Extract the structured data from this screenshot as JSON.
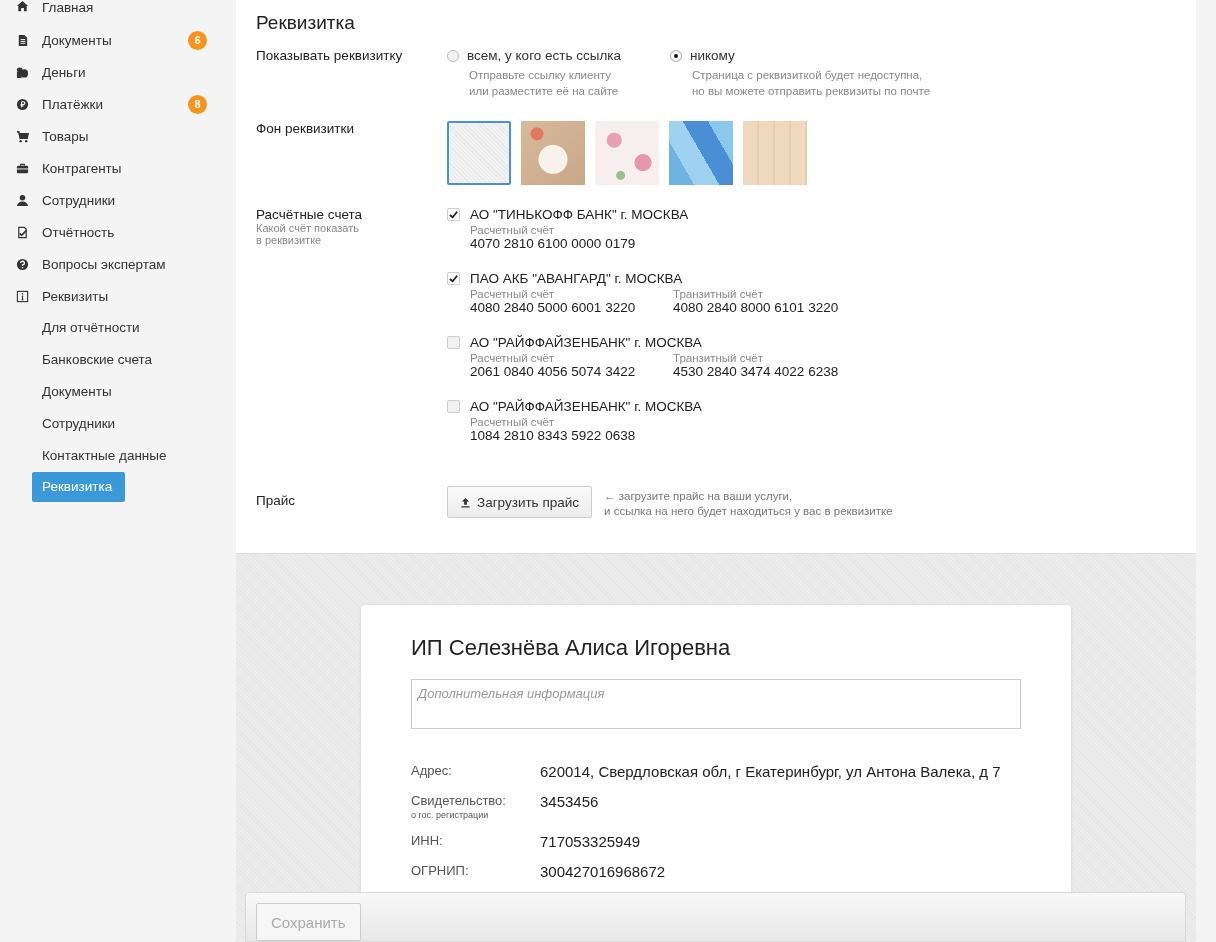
{
  "sidebar": {
    "items": [
      {
        "kind": "home",
        "label": "Главная",
        "selected": false
      },
      {
        "kind": "docs",
        "label": "Документы",
        "badge": "6",
        "selected": false
      },
      {
        "kind": "coins",
        "label": "Деньги",
        "selected": false
      },
      {
        "kind": "ruble",
        "label": "Платёжки",
        "badge": "8",
        "selected": false
      },
      {
        "kind": "cart",
        "label": "Товары",
        "selected": false
      },
      {
        "kind": "briefcase",
        "label": "Контрагенты",
        "selected": false
      },
      {
        "kind": "person",
        "label": "Сотрудники",
        "selected": false
      },
      {
        "kind": "report",
        "label": "Отчётность",
        "selected": false
      },
      {
        "kind": "question",
        "label": "Вопросы экспертам",
        "selected": false
      },
      {
        "kind": "info",
        "label": "Реквизиты",
        "selected": false,
        "children": [
          {
            "label": "Для отчётности",
            "selected": false
          },
          {
            "label": "Банковские счета",
            "selected": false
          },
          {
            "label": "Документы",
            "selected": false
          },
          {
            "label": "Сотрудники",
            "selected": false
          },
          {
            "label": "Контактные данные",
            "selected": false
          },
          {
            "label": "Реквизитка",
            "selected": true
          }
        ]
      }
    ]
  },
  "settings": {
    "title": "Реквизитка",
    "visibility": {
      "label": "Показывать реквизитку",
      "options": [
        {
          "label": "всем, у кого есть ссылка",
          "hint": "Отправьте ссылку клиенту\nили разместите её на сайте",
          "selected": false
        },
        {
          "label": "никому",
          "hint": "Страница с реквизиткой будет недоступна,\nно вы можете отправить реквизиты по почте",
          "selected": true
        }
      ]
    },
    "background": {
      "label": "Фон реквизитки",
      "swatches": [
        {
          "kind": "paper",
          "selected": true
        },
        {
          "kind": "desk",
          "selected": false
        },
        {
          "kind": "floral",
          "selected": false
        },
        {
          "kind": "triangles",
          "selected": false
        },
        {
          "kind": "wood",
          "selected": false
        }
      ]
    },
    "accounts": {
      "label": "Расчётные счета",
      "hint": "Какой счёт показать\nв реквизитке",
      "items": [
        {
          "bank": "АО \"ТИНЬКОФФ БАНК\" г. МОСКВА",
          "checked": true,
          "fields": [
            {
              "label": "Расчетный счёт",
              "number": "4070 2810 6100 0000 0179"
            }
          ]
        },
        {
          "bank": "ПАО АКБ \"АВАНГАРД\" г. МОСКВА",
          "checked": true,
          "fields": [
            {
              "label": "Расчетный счёт",
              "number": "4080 2840 5000 6001 3220"
            },
            {
              "label": "Транзитный счёт",
              "number": "4080 2840 8000 6101 3220"
            }
          ]
        },
        {
          "bank": "АО \"РАЙФФАЙЗЕНБАНК\" г. МОСКВА",
          "checked": false,
          "fields": [
            {
              "label": "Расчетный счёт",
              "number": "2061 0840 4056 5074 3422"
            },
            {
              "label": "Транзитный счёт",
              "number": "4530 2840 3474 4022 6238"
            }
          ]
        },
        {
          "bank": "АО \"РАЙФФАЙЗЕНБАНК\" г. МОСКВА",
          "checked": false,
          "fields": [
            {
              "label": "Расчетный счёт",
              "number": "1084 2810 8343 5922 0638"
            }
          ]
        }
      ]
    },
    "price": {
      "label": "Прайс",
      "button": "Загрузить прайс",
      "hint": "← загрузите прайс на ваши услуги,\nи ссылка на него будет находиться у вас в реквизитке"
    }
  },
  "card": {
    "title": "ИП Селезнёва Алиса Игоревна",
    "info_placeholder": "Дополнительная информация",
    "rows": [
      {
        "label": "Адрес:",
        "value": "620014, Свердловская обл, г Екатеринбург, ул Антона Валека, д 7"
      },
      {
        "label": "Свидетельство:",
        "sublabel": "о гос. регистрации",
        "value": "3453456"
      },
      {
        "label": "ИНН:",
        "value": "717053325949"
      },
      {
        "label": "ОГРНИП:",
        "value": "300427016968672"
      }
    ]
  },
  "footer": {
    "save_button": "Сохранить",
    "disabled": true
  }
}
